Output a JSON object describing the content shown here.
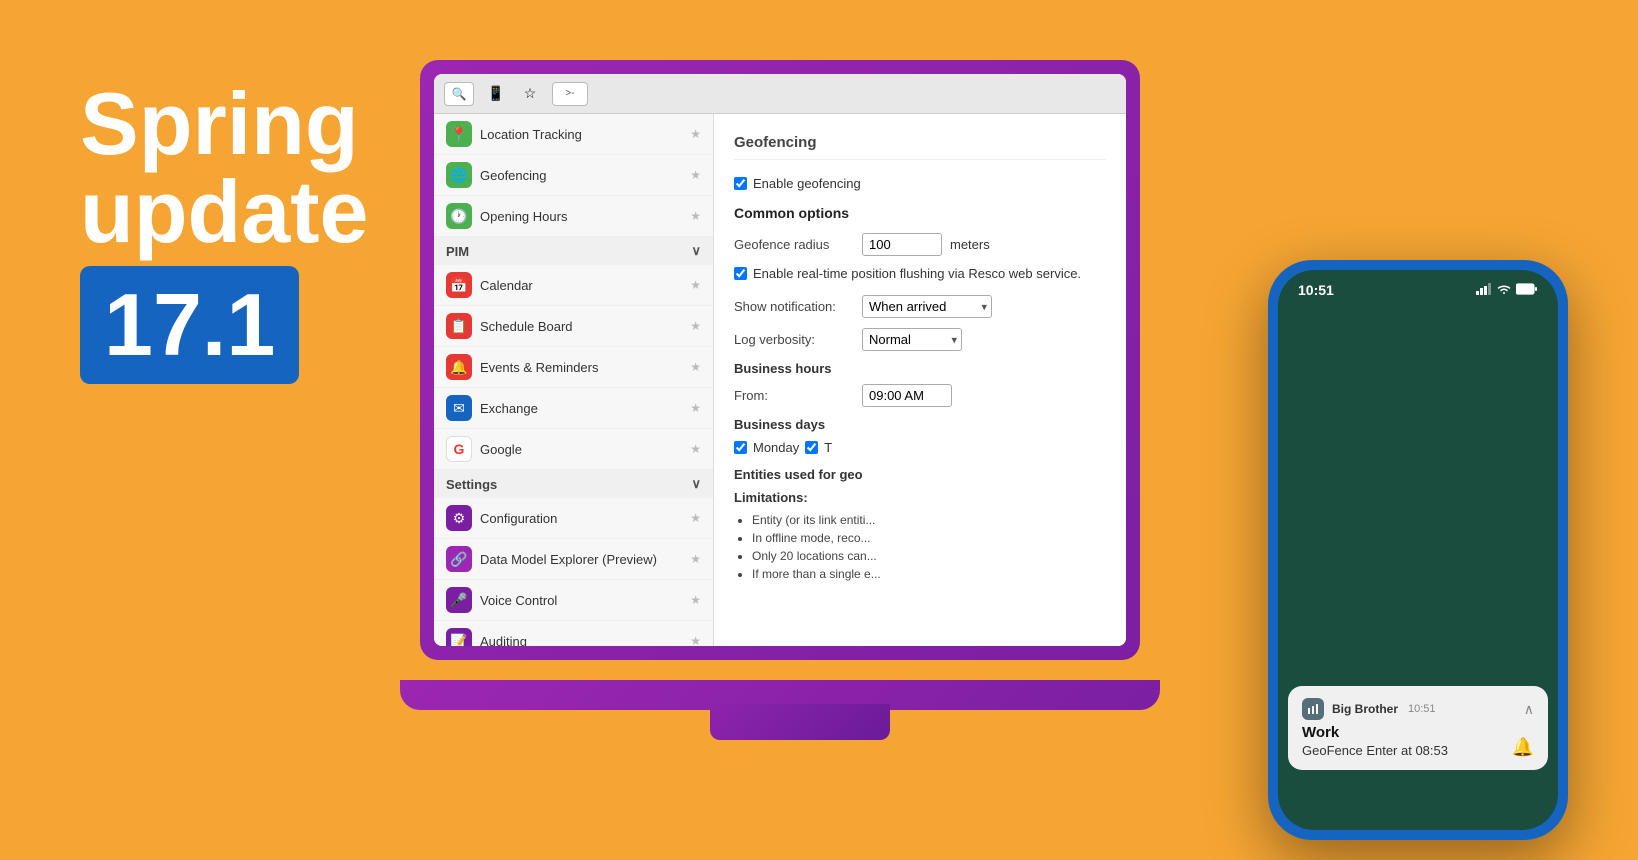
{
  "hero": {
    "title": "Spring\nupdate",
    "badge": "17.1"
  },
  "laptop": {
    "toolbar": {
      "search_placeholder": "🔍",
      "device_icon": "📱",
      "star_icon": "☆",
      "terminal_btn": ">-"
    },
    "sidebar": {
      "items_top": [
        {
          "label": "Location Tracking",
          "icon_bg": "#4CAF50",
          "icon": "📍"
        },
        {
          "label": "Geofencing",
          "icon_bg": "#4CAF50",
          "icon": "🌐"
        },
        {
          "label": "Opening Hours",
          "icon_bg": "#4CAF50",
          "icon": "🕐"
        }
      ],
      "section_pim": "PIM",
      "items_pim": [
        {
          "label": "Calendar",
          "icon_bg": "#E53935",
          "icon": "📅"
        },
        {
          "label": "Schedule Board",
          "icon_bg": "#E53935",
          "icon": "📋"
        },
        {
          "label": "Events & Reminders",
          "icon_bg": "#E53935",
          "icon": "🔔"
        },
        {
          "label": "Exchange",
          "icon_bg": "#1565C0",
          "icon": "✉"
        },
        {
          "label": "Google",
          "icon_bg": "white",
          "icon": "G"
        }
      ],
      "section_settings": "Settings",
      "items_settings": [
        {
          "label": "Configuration",
          "icon_bg": "#7B1FA2",
          "icon": "⚙"
        },
        {
          "label": "Data Model Explorer (Preview)",
          "icon_bg": "#9C27B0",
          "icon": "🔗"
        },
        {
          "label": "Voice Control",
          "icon_bg": "#7B1FA2",
          "icon": "🎤"
        },
        {
          "label": "Auditing",
          "icon_bg": "#7B1FA2",
          "icon": "📝"
        }
      ]
    },
    "main": {
      "panel_title": "Geofencing",
      "enable_geofencing_label": "Enable geofencing",
      "common_options_title": "Common options",
      "geofence_radius_label": "Geofence radius",
      "geofence_radius_value": "100",
      "geofence_radius_unit": "meters",
      "realtime_label": "Enable real-time position flushing via Resco web service.",
      "show_notification_label": "Show notification:",
      "show_notification_value": "When arrived",
      "log_verbosity_label": "Log verbosity:",
      "log_verbosity_value": "Normal",
      "business_hours_title": "Business hours",
      "from_label": "From:",
      "from_value": "09:00 AM",
      "business_days_title": "Business days",
      "day_monday": "Monday",
      "day_tuesday": "T",
      "entities_title": "Entities used for geo",
      "limitations_title": "Limitations:",
      "limitation_1": "Entity (or its link entiti...",
      "limitation_2": "In offline mode, reco...",
      "limitation_3": "Only 20 locations can...",
      "limitation_4": "If more than a single e..."
    }
  },
  "phone": {
    "time": "10:51",
    "signal_icon": "📶",
    "wifi_icon": "WiFi",
    "battery_icon": "🔋",
    "notification": {
      "app_name": "Big Brother",
      "notif_time": "10:51",
      "title": "Work",
      "body": "GeoFence Enter at 08:53",
      "bell_icon": "🔔"
    }
  }
}
